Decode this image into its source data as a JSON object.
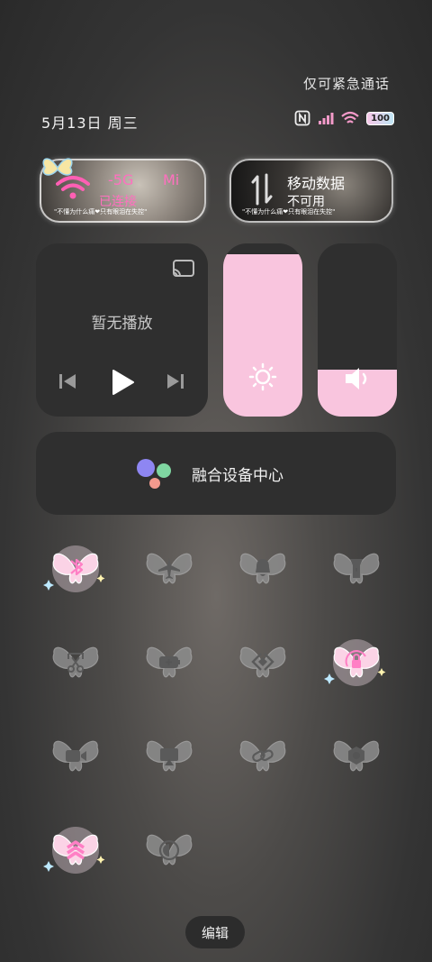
{
  "status_bar": {
    "emergency_text": "仅可紧急通话",
    "date": "5月13日 周三",
    "battery": "100",
    "icons": [
      "nfc-icon",
      "signal-icon",
      "wifi-icon",
      "battery-icon"
    ]
  },
  "wifi_tile": {
    "title": "-5G",
    "title_suffix": "Mi",
    "status": "已连接",
    "caption": "\"不懂为什么痛❤只有眼泪在失控\""
  },
  "data_tile": {
    "title": "移动数据",
    "status": "不可用",
    "caption": "\"不懂为什么痛❤只有眼泪在失控\""
  },
  "media": {
    "status": "暂无播放"
  },
  "brightness": {
    "level": 0.94
  },
  "volume": {
    "level": 0.27
  },
  "hub": {
    "label": "融合设备中心"
  },
  "toggles": [
    {
      "name": "bluetooth",
      "active": true
    },
    {
      "name": "airplane",
      "active": false
    },
    {
      "name": "silent",
      "active": false
    },
    {
      "name": "flashlight",
      "active": false
    },
    {
      "name": "screenshot",
      "active": false
    },
    {
      "name": "battery-saver",
      "active": false
    },
    {
      "name": "hotspot",
      "active": false
    },
    {
      "name": "rotation-lock",
      "active": true
    },
    {
      "name": "screen-record",
      "active": false
    },
    {
      "name": "cast",
      "active": false
    },
    {
      "name": "link",
      "active": false
    },
    {
      "name": "settings",
      "active": false
    },
    {
      "name": "performance",
      "active": true
    },
    {
      "name": "dark-mode",
      "active": false
    }
  ],
  "colors": {
    "accent_pink": "#f9c5de",
    "active_pink": "#ff7fc5",
    "inactive": "#9a9a9a"
  },
  "edit": {
    "label": "编辑"
  }
}
